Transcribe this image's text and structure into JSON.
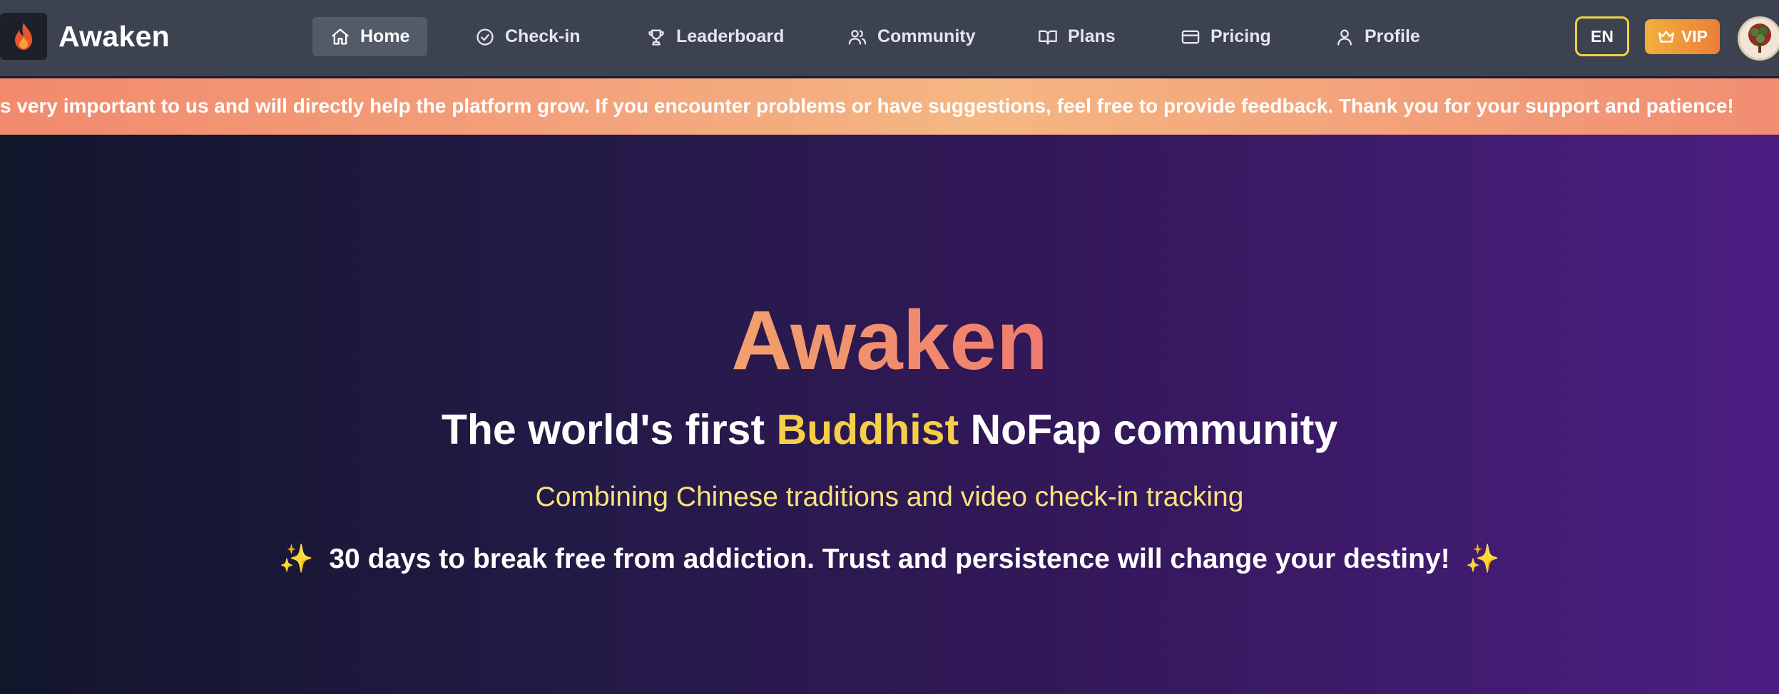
{
  "brand": {
    "name": "Awaken",
    "logo_icon": "flame-icon"
  },
  "nav": {
    "items": [
      {
        "label": "Home",
        "icon": "home-icon",
        "active": true
      },
      {
        "label": "Check-in",
        "icon": "check-circle-icon"
      },
      {
        "label": "Leaderboard",
        "icon": "trophy-icon"
      },
      {
        "label": "Community",
        "icon": "users-icon"
      },
      {
        "label": "Plans",
        "icon": "book-icon"
      },
      {
        "label": "Pricing",
        "icon": "credit-card-icon"
      },
      {
        "label": "Profile",
        "icon": "user-icon"
      }
    ],
    "language": "EN",
    "vip": "VIP"
  },
  "banner": {
    "text": "s very important to us and will directly help the platform grow. If you encounter problems or have suggestions, feel free to provide feedback. Thank you for your support and patience!"
  },
  "hero": {
    "title": "Awaken",
    "subtitle_pre": "The world's first ",
    "subtitle_highlight": "Buddhist",
    "subtitle_post": " NoFap community",
    "tagline": "Combining Chinese traditions and video check-in tracking",
    "motto": "30 days to break free from addiction. Trust and persistence will change your destiny!",
    "sparkle": "✨"
  },
  "colors": {
    "nav_bg": "#3c424f",
    "accent_yellow": "#f6cf48",
    "banner_orange": "#f3a47c",
    "hero_purple": "#4b1f82"
  }
}
